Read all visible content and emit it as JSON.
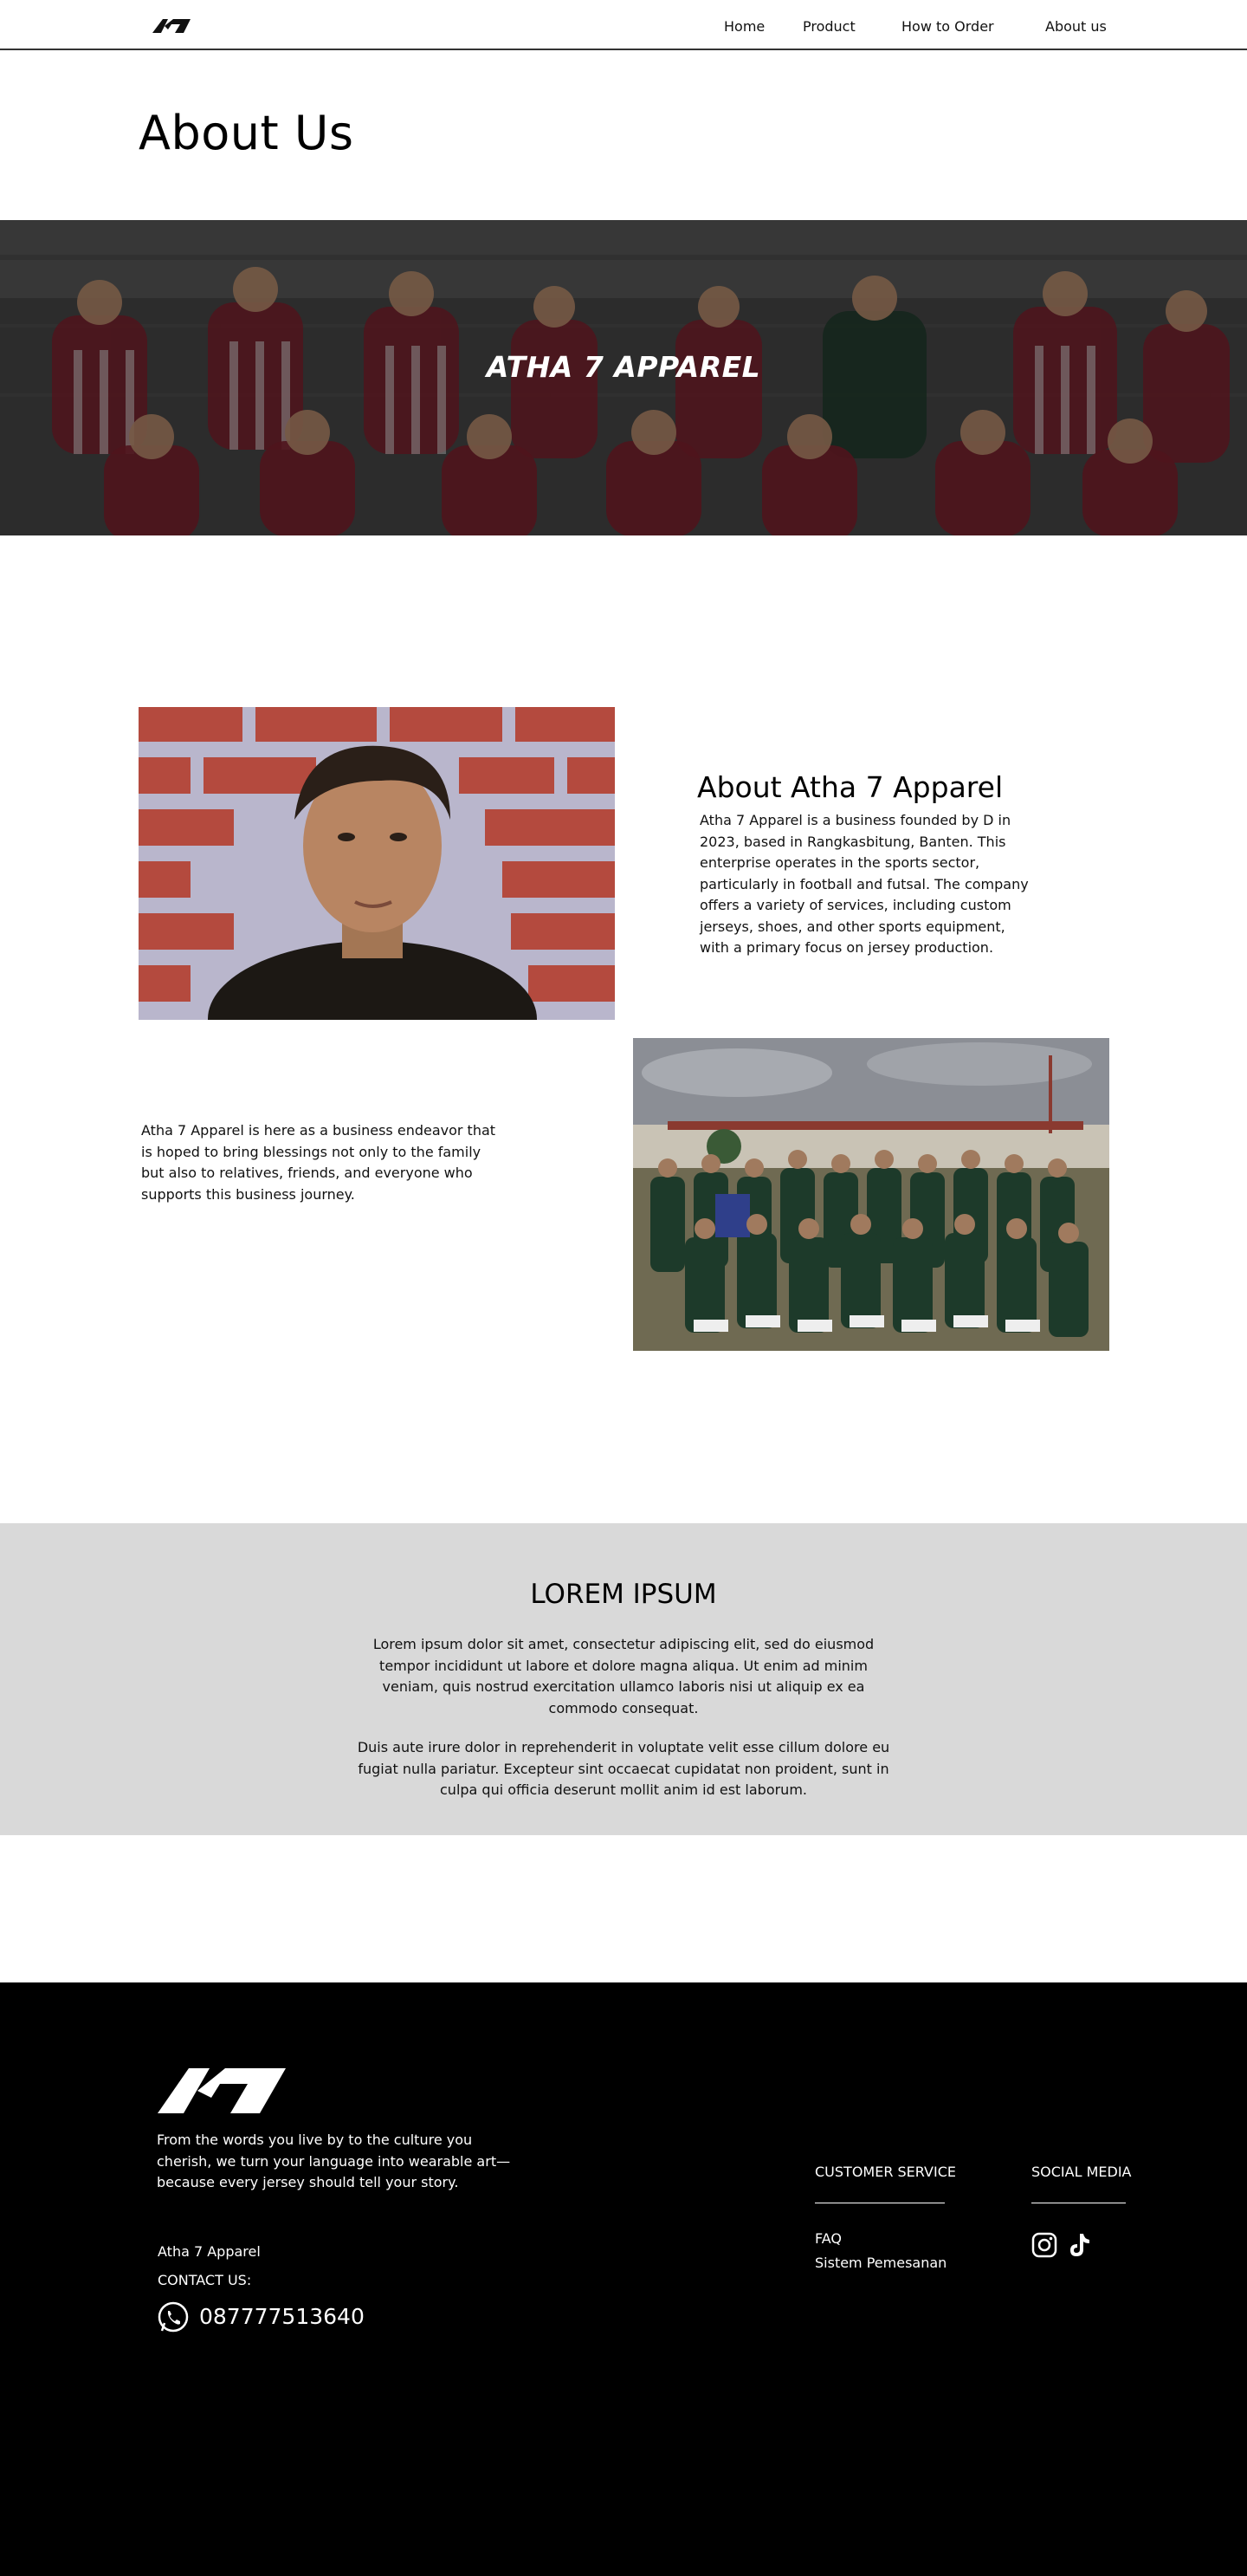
{
  "nav": {
    "logo_name": "atha-7-logo",
    "links": [
      "Home",
      "Product",
      "How to Order",
      "About us"
    ]
  },
  "page": {
    "title": "About Us"
  },
  "hero": {
    "title": "ATHA 7 APPAREL"
  },
  "about": {
    "heading": "About Atha 7 Apparel",
    "text": "Atha 7 Apparel is a business founded by D in 2023, based in Rangkasbitung, Banten. This enterprise operates in the sports sector, particularly in football and futsal. The company offers a variety of services, including custom jerseys, shoes, and other sports equipment, with a primary focus on jersey production."
  },
  "mission": {
    "text": "Atha 7 Apparel is here as a business endeavor that is hoped to bring blessings not only to the family but also to relatives, friends, and everyone who supports this business journey."
  },
  "lorem": {
    "title": "LOREM IPSUM",
    "p1": "Lorem ipsum dolor sit amet, consectetur adipiscing elit, sed do eiusmod tempor incididunt ut labore et dolore magna aliqua. Ut enim ad minim veniam, quis nostrud exercitation ullamco laboris nisi ut aliquip ex ea commodo consequat.",
    "p2": "Duis aute irure dolor in reprehenderit in voluptate velit esse cillum dolore eu fugiat nulla pariatur. Excepteur sint occaecat cupidatat non proident, sunt in culpa qui officia deserunt mollit anim id est laborum."
  },
  "footer": {
    "tagline": "From the words you live by to the culture you cherish, we turn your language into wearable art—because every jersey should tell your story.",
    "company": "Atha 7 Apparel",
    "contact_label": "CONTACT US:",
    "phone": "087777513640",
    "customer_service": {
      "heading": "CUSTOMER SERVICE",
      "links": [
        "FAQ",
        "Sistem Pemesanan"
      ]
    },
    "social_media": {
      "heading": "SOCIAL MEDIA",
      "icons": [
        "instagram-icon",
        "tiktok-icon"
      ]
    }
  },
  "colors": {
    "text": "#111111",
    "footer_bg": "#000000",
    "grey_section": "#d9d9d9",
    "jersey_maroon": "#7a1f2b",
    "jersey_green": "#1f3a2a"
  }
}
